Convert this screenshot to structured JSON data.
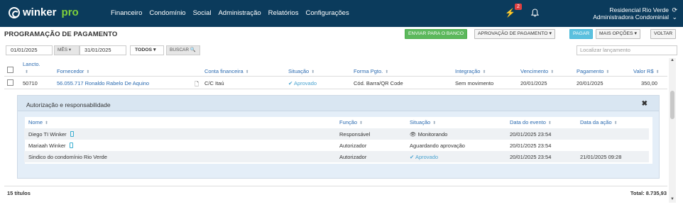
{
  "app": {
    "brand": "winker",
    "brand_suffix": "pro"
  },
  "nav": [
    "Financeiro",
    "Condomínio",
    "Social",
    "Administração",
    "Relatórios",
    "Configurações"
  ],
  "notifications": {
    "count": "2"
  },
  "condo": {
    "name": "Residencial Rio Verde",
    "role": "Administradora Condominial"
  },
  "page": {
    "title": "PROGRAMAÇÃO DE PAGAMENTO"
  },
  "toolbar": {
    "send_bank": "ENVIAR PARA O BANCO",
    "approval": "APROVAÇÃO DE PAGAMENTO",
    "pay": "PAGAR",
    "more": "MAIS OPÇÕES",
    "back": "VOLTAR"
  },
  "filters": {
    "date_from": "01/01/2025",
    "period": "MÊS",
    "date_to": "31/01/2025",
    "status": "TODOS",
    "search_btn": "BUSCAR",
    "search_placeholder": "Localizar lançamento"
  },
  "table": {
    "headers": {
      "lancto": "Lancto.",
      "fornecedor": "Fornecedor",
      "conta": "Conta financeira",
      "situacao": "Situação",
      "forma": "Forma Pgto.",
      "integracao": "Integração",
      "vencimento": "Vencimento",
      "pagamento": "Pagamento",
      "valor": "Valor R$"
    },
    "row": {
      "lancto": "50710",
      "fornecedor": "56.055.717 Ronaldo Rabelo De Aquino",
      "conta": "C/C Itaú",
      "situacao": "Aprovado",
      "forma": "Cód. Barra/QR Code",
      "integracao": "Sem movimento",
      "vencimento": "20/01/2025",
      "pagamento": "20/01/2025",
      "valor": "350,00"
    }
  },
  "panel": {
    "title": "Autorização e responsabilidade",
    "headers": {
      "nome": "Nome",
      "funcao": "Função",
      "situacao": "Situação",
      "data_evento": "Data do evento",
      "data_acao": "Data da ação"
    },
    "rows": [
      {
        "nome": "Diego TI Winker",
        "funcao": "Responsável",
        "situacao": "Monitorando",
        "data_evento": "20/01/2025 23:54",
        "data_acao": ""
      },
      {
        "nome": "Mariaah Winker",
        "funcao": "Autorizador",
        "situacao": "Aguardando aprovação",
        "data_evento": "20/01/2025 23:54",
        "data_acao": ""
      },
      {
        "nome": "Sindico do condomínio Rio Verde",
        "funcao": "Autorizador",
        "situacao": "Aprovado",
        "data_evento": "20/01/2025 23:54",
        "data_acao": "21/01/2025 09:28"
      }
    ]
  },
  "footer": {
    "count": "15 títulos",
    "total": "Total: 8.735,93"
  },
  "colors": {
    "nav_bg": "#0b3b5c",
    "brand_accent": "#7fd13b",
    "link": "#2a6ab0",
    "approved": "#4aa3d0",
    "send_bank": "#5cb85c",
    "pay": "#5bc0de"
  }
}
